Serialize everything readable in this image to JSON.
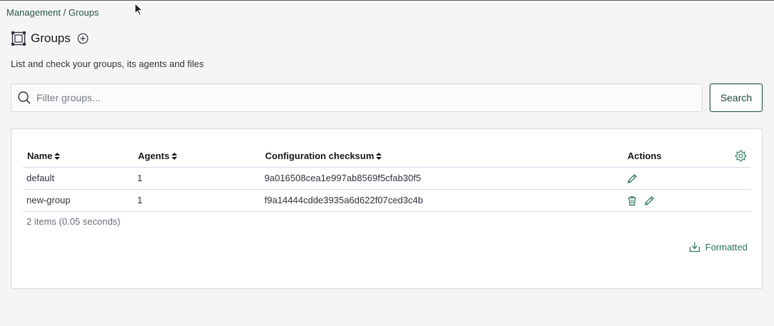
{
  "breadcrumb": "Management / Groups",
  "header": {
    "title": "Groups",
    "subtitle": "List and check your groups, its agents and files"
  },
  "search": {
    "placeholder": "Filter groups...",
    "value": "",
    "button_label": "Search"
  },
  "table": {
    "columns": [
      "Name",
      "Agents",
      "Configuration checksum",
      "Actions"
    ],
    "rows": [
      {
        "name": "default",
        "agents": "1",
        "checksum": "9a016508cea1e997ab8569f5cfab30f5",
        "actions": [
          "edit-icon"
        ]
      },
      {
        "name": "new-group",
        "agents": "1",
        "checksum": "f9a14444cdde3935a6d622f07ced3c4b",
        "actions": [
          "delete-icon",
          "edit-icon"
        ]
      }
    ],
    "summary": "2 items (0.05 seconds)"
  },
  "export": {
    "label": "Formatted"
  },
  "colors": {
    "accent": "#2c7a5a",
    "dark_green": "#1f4f3d",
    "border": "#d3dae6"
  }
}
